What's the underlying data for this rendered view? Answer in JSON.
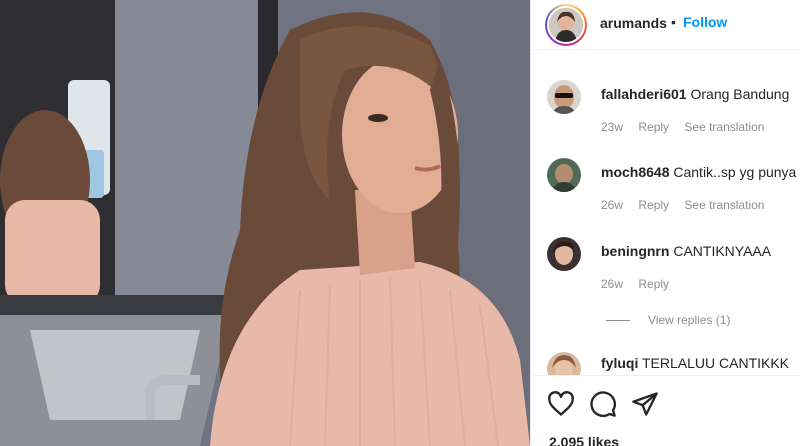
{
  "post": {
    "image_alt": "Photo of a woman in a pink knit top with long brown hair",
    "author": {
      "username": "arumands",
      "separator": "•",
      "follow_label": "Follow"
    },
    "comments": [
      {
        "username": "fallahderi601",
        "text": "Orang Bandung",
        "age": "23w",
        "reply_label": "Reply",
        "translate_label": "See translation"
      },
      {
        "username": "moch8648",
        "text": "Cantik..sp yg punya",
        "age": "26w",
        "reply_label": "Reply",
        "translate_label": "See translation"
      },
      {
        "username": "beningnrn",
        "text": "CANTIKNYAAA",
        "age": "26w",
        "reply_label": "Reply"
      },
      {
        "username": "fyluqi",
        "text": "TERLALUU CANTIKKK"
      }
    ],
    "view_replies_label": "View replies (1)",
    "likes_text": "2,095 likes",
    "icons": {
      "like": "heart-icon",
      "comment": "comment-bubble-icon",
      "share": "paper-plane-icon"
    },
    "colors": {
      "link": "#0095f6",
      "muted": "#8e8e8e",
      "text": "#262626"
    }
  }
}
